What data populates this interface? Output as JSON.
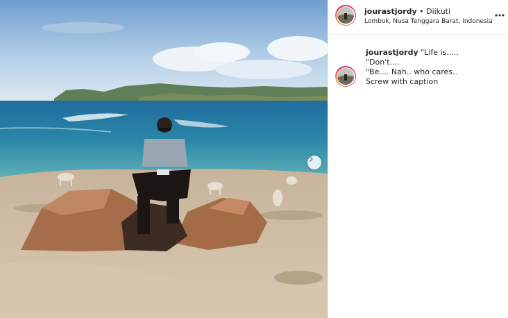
{
  "post": {
    "username": "jourastjordy",
    "separator": " • ",
    "follow_status": "Diikuti",
    "location": "Lombok, Nusa Tenggara Barat, Indonesia"
  },
  "caption": {
    "username": "jourastjordy",
    "line1": " \"Life is.....",
    "line2": "\"Don't....",
    "line3": "\"Be.... Nah.. who cares..",
    "line4": "Screw with caption"
  },
  "icons": {
    "more": "more-options-icon",
    "next": "chevron-right-icon"
  },
  "colors": {
    "text": "#262626",
    "border": "#efefef",
    "story_ring_start": "#f7b733",
    "story_ring_end": "#c13584"
  }
}
